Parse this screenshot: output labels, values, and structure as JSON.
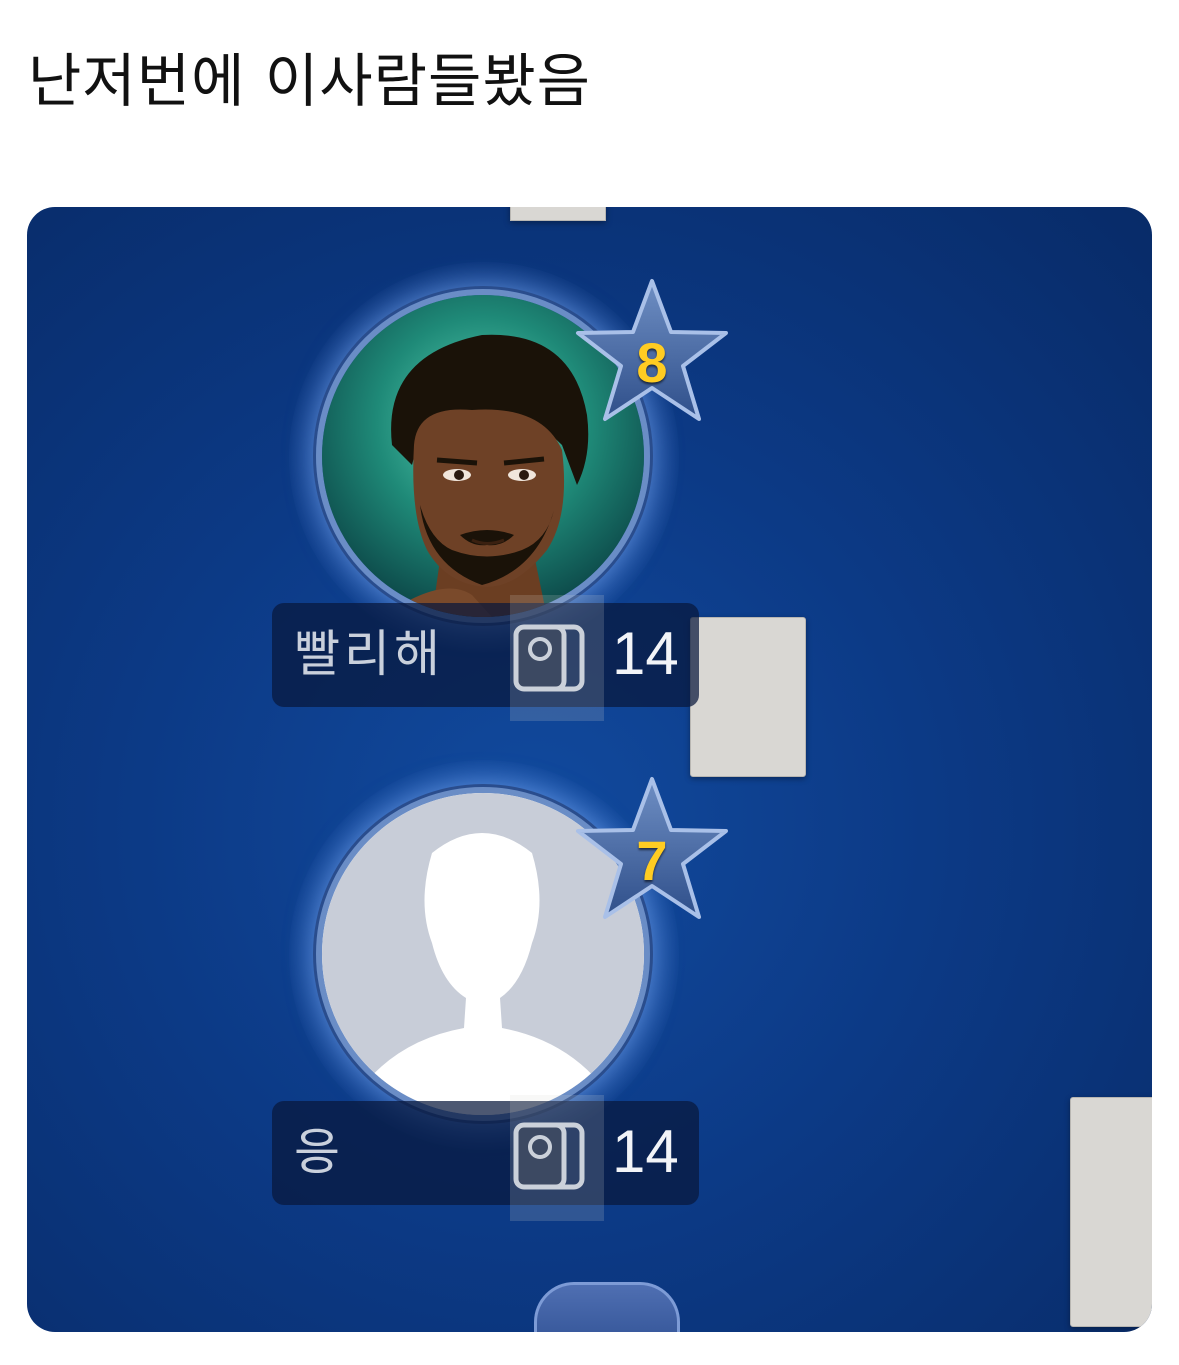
{
  "post": {
    "text": "난저번에 이사람들봤음"
  },
  "game": {
    "players": [
      {
        "name": "빨리해",
        "level": "8",
        "cards": "14",
        "avatar": "illustrated-man-avatar"
      },
      {
        "name": "응",
        "level": "7",
        "cards": "14",
        "avatar": "default-silhouette-avatar"
      }
    ],
    "more_button_icon": "ellipsis-icon",
    "more_button_glyph": "•••"
  },
  "colors": {
    "table_background": "#0c3a86",
    "level_number": "#ffcc22",
    "card_back": "#d9d7d3"
  }
}
